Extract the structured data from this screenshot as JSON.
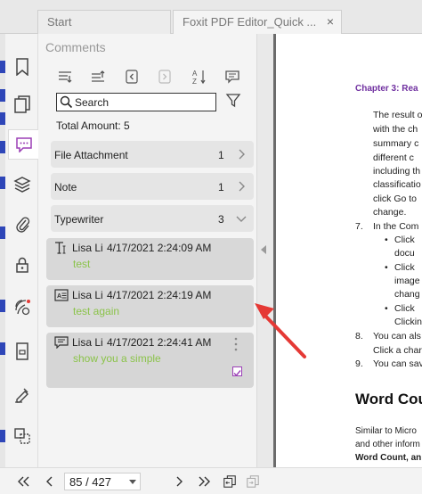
{
  "tabs": [
    {
      "label": "Start"
    },
    {
      "label": "Foxit PDF Editor_Quick ...",
      "close": "×"
    }
  ],
  "rail": {
    "icons": [
      "bookmark-icon",
      "pages-icon",
      "comments-icon",
      "layers-icon",
      "attachment-icon",
      "security-icon",
      "signature-icon",
      "form-icon",
      "fill-sign-icon",
      "compare-icon"
    ]
  },
  "panel": {
    "title": "Comments",
    "tools": [
      "expand-all-icon",
      "collapse-all-icon",
      "previous-comment-icon",
      "next-comment-icon",
      "sort-icon",
      "summary-icon"
    ],
    "search": {
      "placeholder": "Search",
      "value": ""
    },
    "total": "Total Amount: 5",
    "groups": [
      {
        "label": "File Attachment",
        "count": "1",
        "state": "collapsed"
      },
      {
        "label": "Note",
        "count": "1",
        "state": "collapsed"
      },
      {
        "label": "Typewriter",
        "count": "3",
        "state": "expanded"
      }
    ],
    "comments": [
      {
        "icon": "typewriter-icon",
        "author": "Lisa Li",
        "date": "4/17/2021 2:24:09 AM",
        "text": "test"
      },
      {
        "icon": "textbox-icon",
        "author": "Lisa Li",
        "date": "4/17/2021 2:24:19 AM",
        "text": "test again"
      },
      {
        "icon": "callout-icon",
        "author": "Lisa Li",
        "date": "4/17/2021 2:24:41 AM",
        "text": "show you a simple",
        "checked": false
      }
    ]
  },
  "doc": {
    "heading": "Chapter 3: Rea",
    "lines": [
      "The result o",
      "with the ch",
      "summary c",
      "different c",
      "including th",
      "classificatio",
      "click Go to",
      "change.",
      "In the Com",
      "Click",
      "docu",
      "Click",
      "image",
      "chang",
      "Click",
      "Clickin",
      "You can als",
      "Click a char",
      "You can sav"
    ],
    "numbers": [
      "7.",
      "8.",
      "9."
    ],
    "heading2": "Word Cou",
    "para": [
      "Similar to Micro",
      "and other inform",
      "Word Count, an"
    ]
  },
  "nav": {
    "page": "85 / 427"
  },
  "colors": {
    "accent": "#9b3fb6",
    "comment_text": "#8bc34a",
    "heading": "#7030a0",
    "arrow": "#e53935"
  }
}
